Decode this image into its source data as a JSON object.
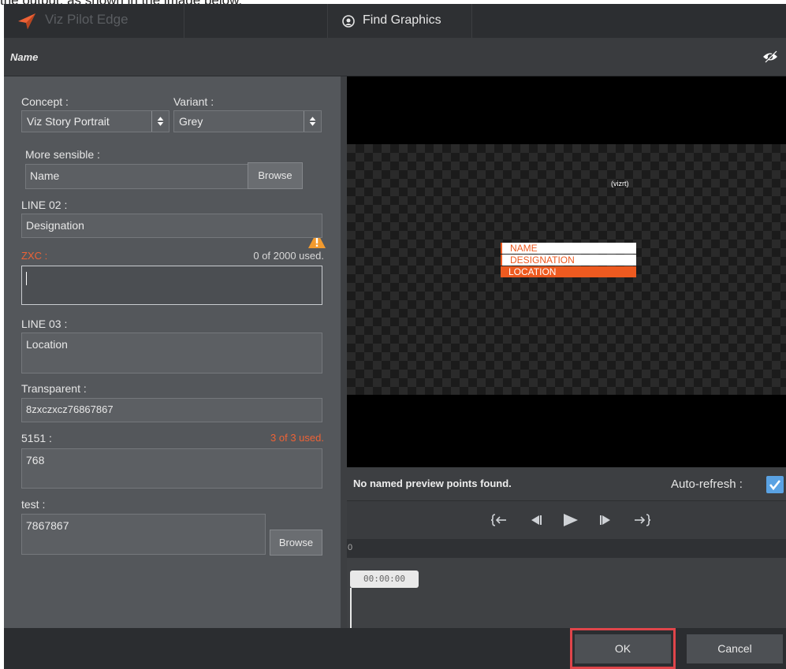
{
  "caption": "the output, as shown in the image below.",
  "app": {
    "title": "Viz Pilot Edge",
    "find_tab": "Find Graphics"
  },
  "editor": {
    "title": "Name"
  },
  "form": {
    "concept_label": "Concept :",
    "concept_value": "Viz Story Portrait",
    "variant_label": "Variant :",
    "variant_value": "Grey",
    "more_sensible_label": "More sensible :",
    "more_sensible_value": "Name",
    "browse_label": "Browse",
    "line02_label": "LINE 02 :",
    "line02_value": "Designation",
    "zxc_label": "ZXC :",
    "zxc_counter": "0 of 2000 used.",
    "zxc_value": "",
    "line03_label": "LINE 03 :",
    "line03_value": "Location",
    "transparent_label": "Transparent :",
    "transparent_value": "8zxczxcz76867867",
    "f5151_label": "5151 :",
    "f5151_counter": "3 of 3 used.",
    "f5151_value": "768",
    "test_label": "test :",
    "test_value": "7867867",
    "test_browse_label": "Browse"
  },
  "preview": {
    "logo_text": "(vizrt)",
    "lower_third": [
      "NAME",
      "DESIGNATION",
      "LOCATION"
    ],
    "status": "No named preview points found.",
    "auto_refresh_label": "Auto-refresh :",
    "auto_refresh": true,
    "timeline_zero": "0",
    "timecode": "00:00:00"
  },
  "footer": {
    "ok": "OK",
    "cancel": "Cancel"
  },
  "colors": {
    "accent": "#ee6236",
    "checkbox": "#5aa2e3",
    "highlight": "#e0454a"
  }
}
